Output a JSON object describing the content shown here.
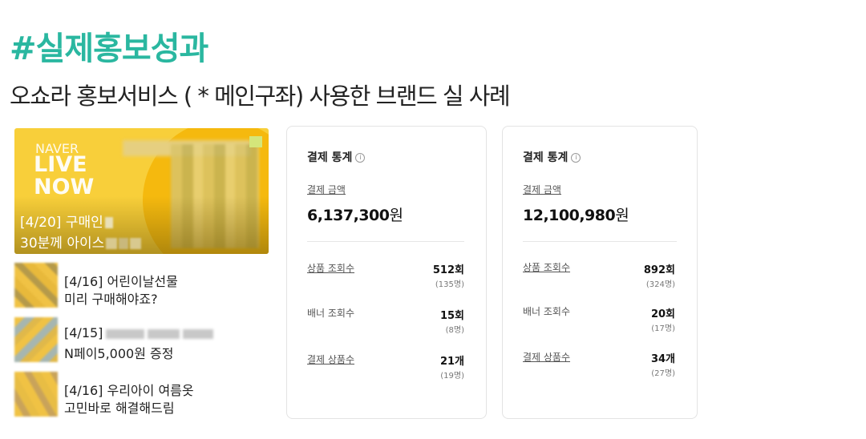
{
  "title": "#실제홍보성과",
  "subtitle": "오쇼라 홍보서비스 ( * 메인구좌) 사용한 브랜드 실 사례",
  "live_banner": {
    "brand_top": "NAVER",
    "brand_live": "LIVE",
    "brand_now": "NOW",
    "line1": "[4/20] 구매인",
    "line2": "30분께 아이스"
  },
  "list_items": [
    {
      "line1": "[4/16] 어린이날선물",
      "line2": "미리 구매해야죠?"
    },
    {
      "line1": "[4/15]",
      "line2": "N페이5,000원 증정"
    },
    {
      "line1": "[4/16] 우리아이 여름옷",
      "line2": "고민바로 해결해드림"
    }
  ],
  "cards": [
    {
      "header": "결제 통계",
      "info_icon": "info-icon",
      "amount_label": "결제 금액",
      "amount": "6,137,300",
      "currency": "원",
      "rows": [
        {
          "label": "상품 조회수",
          "value": "512회",
          "sub": "(135명)",
          "underline": true
        },
        {
          "label": "배너 조회수",
          "value": "15회",
          "sub": "(8명)",
          "underline": false
        },
        {
          "label": "결제 상품수",
          "value": "21개",
          "sub": "(19명)",
          "underline": true
        }
      ]
    },
    {
      "header": "결제 통계",
      "info_icon": "info-icon",
      "amount_label": "결제 금액",
      "amount": "12,100,980",
      "currency": "원",
      "rows": [
        {
          "label": "상품 조회수",
          "value": "892회",
          "sub": "(324명)",
          "underline": true
        },
        {
          "label": "배너 조회수",
          "value": "20회",
          "sub": "(17명)",
          "underline": false
        },
        {
          "label": "결제 상품수",
          "value": "34개",
          "sub": "(27명)",
          "underline": true
        }
      ]
    }
  ],
  "colors": {
    "title": "#2ab7a0",
    "banner": "#f8cf3a"
  }
}
